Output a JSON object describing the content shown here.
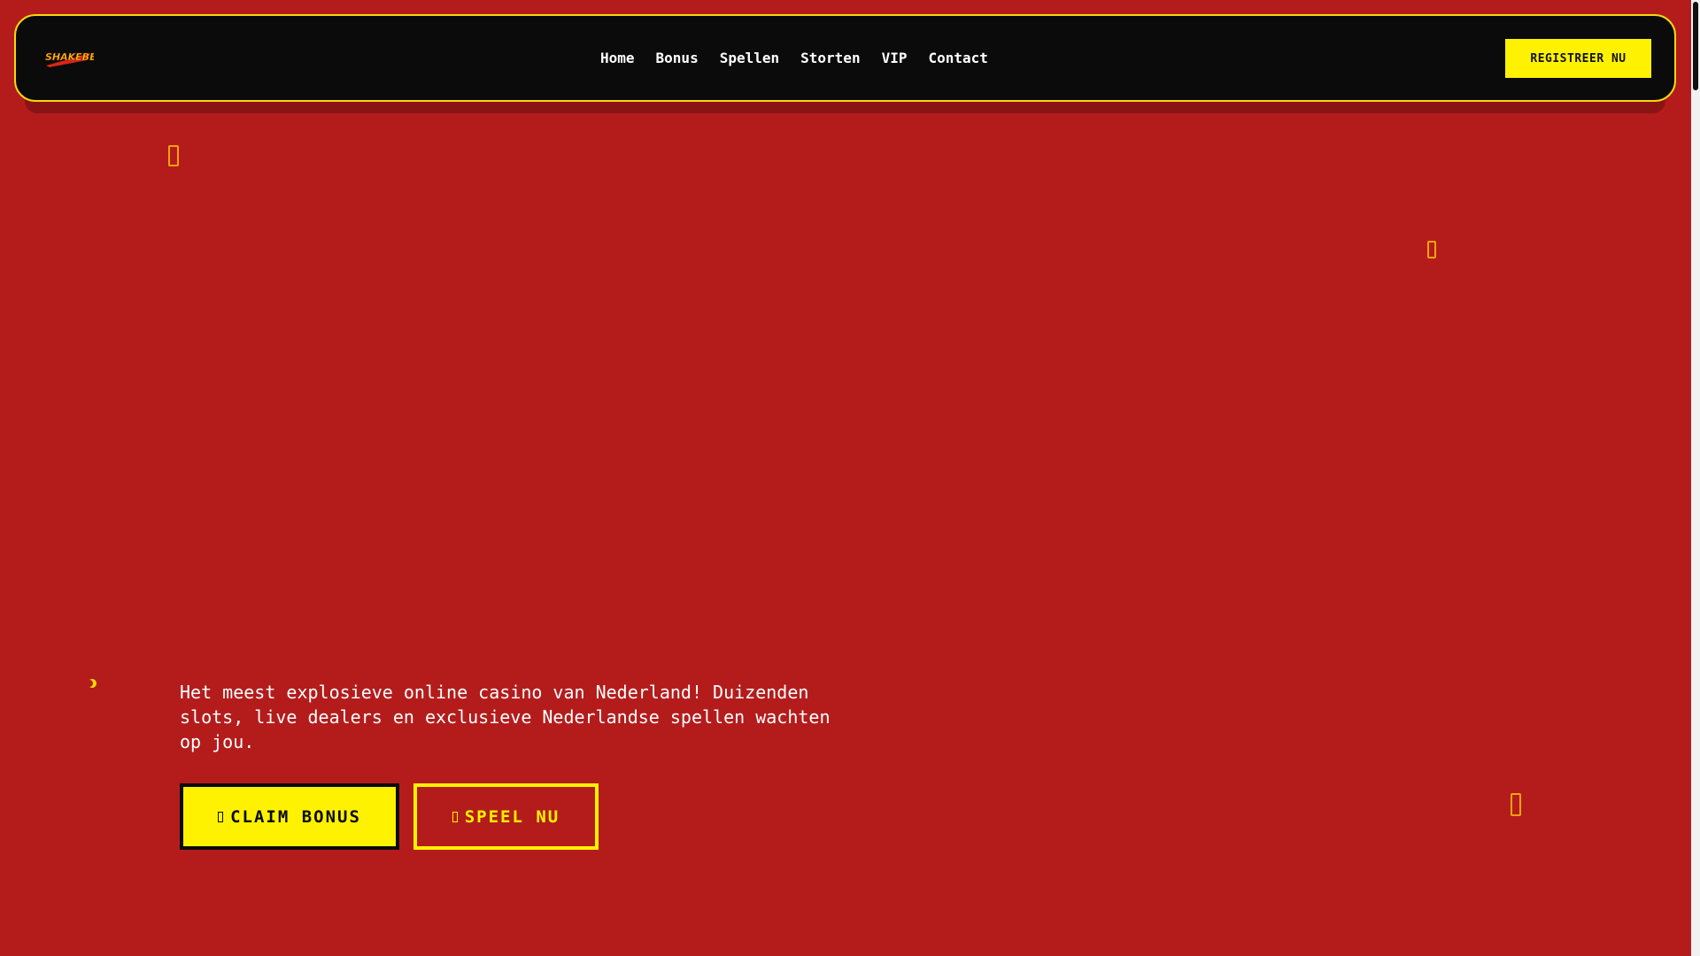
{
  "brand": {
    "logo_text": "SHAKEBET",
    "colors": {
      "background": "#b41c1c",
      "nav_background": "#0b0b0b",
      "accent_yellow": "#fff200",
      "nav_border": "#f5d90a",
      "text": "#ffffff"
    }
  },
  "nav": {
    "links": [
      "Home",
      "Bonus",
      "Spellen",
      "Storten",
      "VIP",
      "Contact"
    ],
    "register_label": "REGISTREER NU"
  },
  "hero": {
    "description": "Het meest explosieve online casino van Nederland! Duizenden slots, live dealers en exclusieve Nederlandse spellen wachten op jou.",
    "claim_label": "CLAIM BONUS",
    "speel_label": "SPEEL NU",
    "claim_icon": "missing-glyph-icon",
    "speel_icon": "missing-glyph-icon"
  },
  "decorations": {
    "floating_icons": [
      "missing-glyph-icon",
      "missing-glyph-icon",
      "missing-glyph-icon",
      "crescent-icon"
    ]
  }
}
